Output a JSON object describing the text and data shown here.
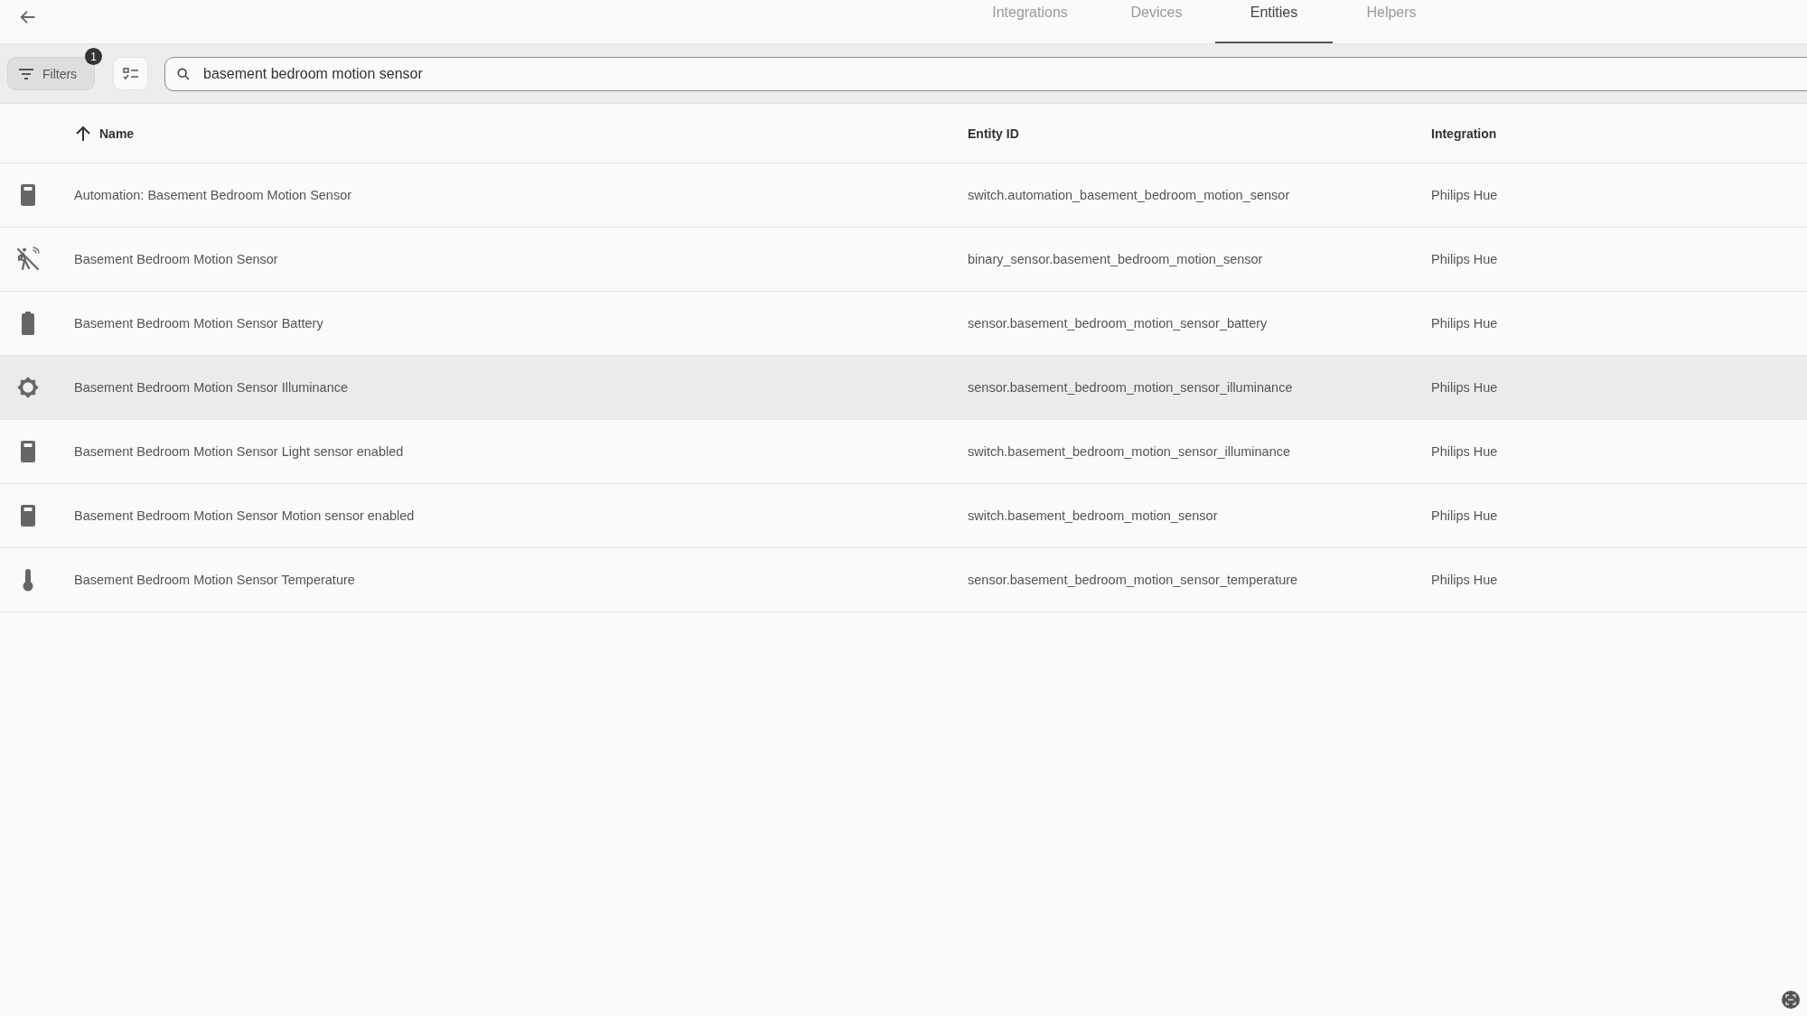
{
  "tabs": [
    {
      "label": "Integrations",
      "selected": false
    },
    {
      "label": "Devices",
      "selected": false
    },
    {
      "label": "Entities",
      "selected": true
    },
    {
      "label": "Helpers",
      "selected": false
    }
  ],
  "toolbar": {
    "filters": {
      "label": "Filters",
      "badge": "1"
    },
    "search": {
      "value": "basement bedroom motion sensor"
    }
  },
  "table": {
    "columns": [
      {
        "label": "Name",
        "sorted": true
      },
      {
        "label": "Entity ID",
        "sorted": false
      },
      {
        "label": "Integration",
        "sorted": false
      }
    ],
    "rows": [
      {
        "kind": "switch",
        "highlighted": false,
        "name": "Automation: Basement Bedroom Motion Sensor",
        "entity_id": "switch.automation_basement_bedroom_motion_sensor",
        "integration": "Philips Hue"
      },
      {
        "kind": "motion",
        "highlighted": false,
        "name": "Basement Bedroom Motion Sensor",
        "entity_id": "binary_sensor.basement_bedroom_motion_sensor",
        "integration": "Philips Hue"
      },
      {
        "kind": "battery",
        "highlighted": false,
        "name": "Basement Bedroom Motion Sensor Battery",
        "entity_id": "sensor.basement_bedroom_motion_sensor_battery",
        "integration": "Philips Hue"
      },
      {
        "kind": "brightness",
        "highlighted": true,
        "name": "Basement Bedroom Motion Sensor Illuminance",
        "entity_id": "sensor.basement_bedroom_motion_sensor_illuminance",
        "integration": "Philips Hue"
      },
      {
        "kind": "switch",
        "highlighted": false,
        "name": "Basement Bedroom Motion Sensor Light sensor enabled",
        "entity_id": "switch.basement_bedroom_motion_sensor_illuminance",
        "integration": "Philips Hue"
      },
      {
        "kind": "switch",
        "highlighted": false,
        "name": "Basement Bedroom Motion Sensor Motion sensor enabled",
        "entity_id": "switch.basement_bedroom_motion_sensor",
        "integration": "Philips Hue"
      },
      {
        "kind": "thermometer",
        "highlighted": false,
        "name": "Basement Bedroom Motion Sensor Temperature",
        "entity_id": "sensor.basement_bedroom_motion_sensor_temperature",
        "integration": "Philips Hue"
      }
    ]
  }
}
